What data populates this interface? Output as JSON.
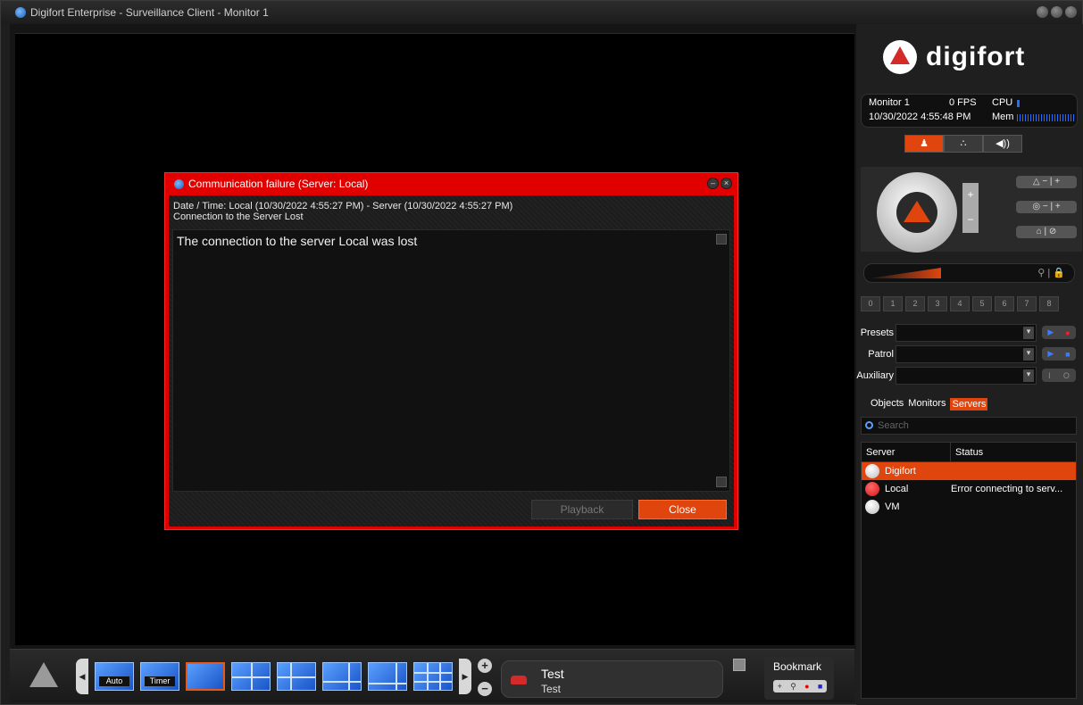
{
  "window": {
    "title": "Digifort Enterprise - Surveillance Client - Monitor 1"
  },
  "dialog": {
    "title": "Communication failure (Server: Local)",
    "datetime": "Date / Time: Local (10/30/2022 4:55:27 PM) - Server (10/30/2022 4:55:27 PM)",
    "subtitle": "Connection to the Server Lost",
    "message": "The connection to the server Local was lost",
    "playback_label": "Playback",
    "close_label": "Close"
  },
  "toolbar": {
    "layouts": [
      {
        "label": "Auto"
      },
      {
        "label": "Timer"
      }
    ],
    "profile": {
      "name": "Test",
      "sub": "Test"
    },
    "bookmark_label": "Bookmark"
  },
  "panel": {
    "logo_text": "digifort",
    "status": {
      "monitor": "Monitor 1",
      "fps": "0 FPS",
      "cpu": "CPU",
      "datetime": "10/30/2022 4:55:48 PM",
      "mem": "Mem"
    },
    "preset_numbers": [
      "0",
      "1",
      "2",
      "3",
      "4",
      "5",
      "6",
      "7",
      "8"
    ],
    "presets_label": "Presets",
    "patrol_label": "Patrol",
    "auxiliary_label": "Auxiliary",
    "tabs": [
      {
        "label": "Objects",
        "active": false
      },
      {
        "label": "Monitors",
        "active": false
      },
      {
        "label": "Servers",
        "active": true
      }
    ],
    "search_placeholder": "Search",
    "list_headers": {
      "server": "Server",
      "status": "Status"
    },
    "servers": [
      {
        "name": "Digifort",
        "status": "",
        "dot": "white",
        "selected": true
      },
      {
        "name": "Local",
        "status": "Error connecting to serv...",
        "dot": "red",
        "selected": false
      },
      {
        "name": "VM",
        "status": "",
        "dot": "white",
        "selected": false
      }
    ]
  },
  "colors": {
    "accent": "#e0450e",
    "dialog_border": "#e00000",
    "status_bar_blue": "#2a6cff"
  }
}
